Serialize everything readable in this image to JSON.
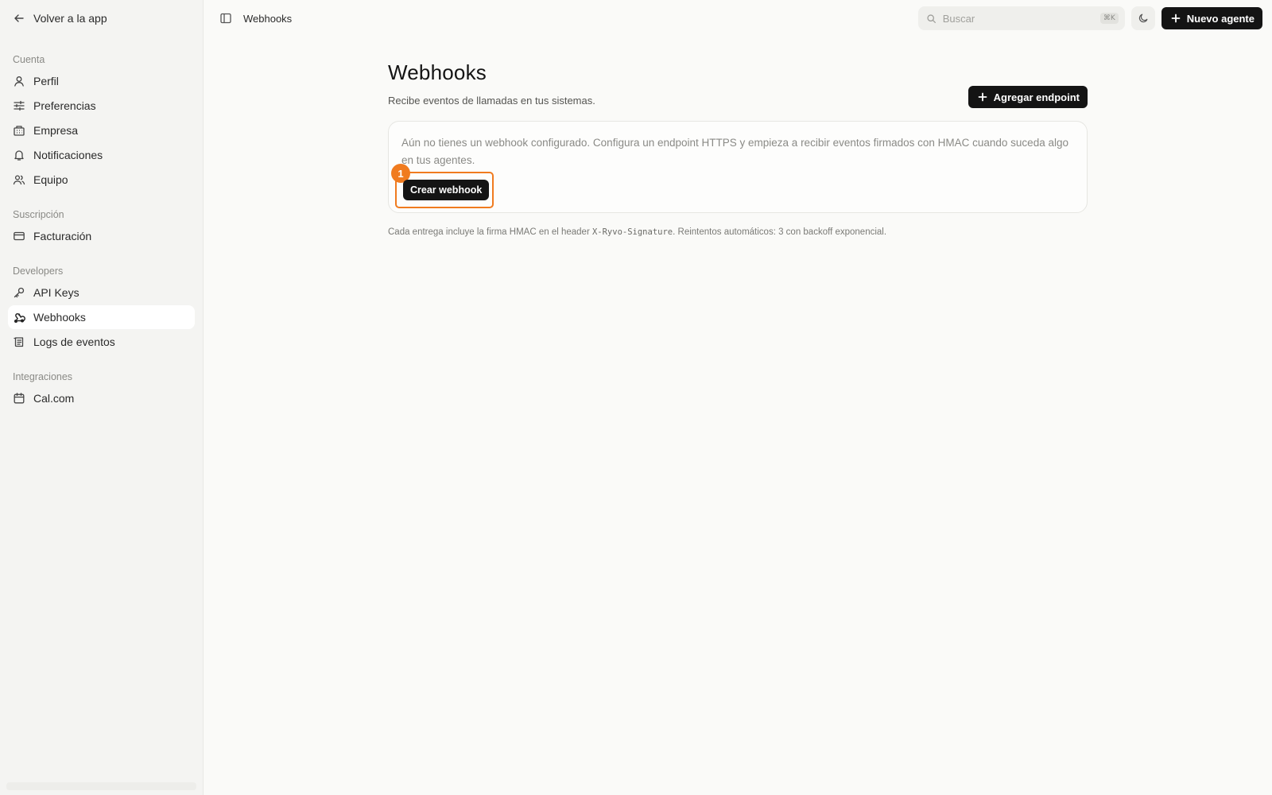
{
  "sidebar": {
    "back_label": "Volver a la app",
    "sections": [
      {
        "label": "Cuenta",
        "items": [
          {
            "label": "Perfil",
            "icon": "user-icon"
          },
          {
            "label": "Preferencias",
            "icon": "sliders-icon"
          },
          {
            "label": "Empresa",
            "icon": "building-icon"
          },
          {
            "label": "Notificaciones",
            "icon": "bell-icon"
          },
          {
            "label": "Equipo",
            "icon": "users-icon"
          }
        ]
      },
      {
        "label": "Suscripción",
        "items": [
          {
            "label": "Facturación",
            "icon": "credit-card-icon"
          }
        ]
      },
      {
        "label": "Developers",
        "items": [
          {
            "label": "API Keys",
            "icon": "key-icon"
          },
          {
            "label": "Webhooks",
            "icon": "webhook-icon",
            "active": true
          },
          {
            "label": "Logs de eventos",
            "icon": "log-icon"
          }
        ]
      },
      {
        "label": "Integraciones",
        "items": [
          {
            "label": "Cal.com",
            "icon": "calendar-icon"
          }
        ]
      }
    ]
  },
  "topbar": {
    "breadcrumb": "Webhooks",
    "search_placeholder": "Buscar",
    "search_shortcut": "⌘K",
    "new_agent_label": "Nuevo agente"
  },
  "page": {
    "title": "Webhooks",
    "subtitle": "Recibe eventos de llamadas en tus sistemas.",
    "add_endpoint_label": "Agregar endpoint",
    "empty_state_text": "Aún no tienes un webhook configurado. Configura un endpoint HTTPS y empieza a recibir eventos firmados con HMAC cuando suceda algo en tus agentes.",
    "create_webhook_label": "Crear webhook",
    "annotation_badge": "1",
    "footnote_before": "Cada entrega incluye la firma HMAC en el header ",
    "footnote_code": "X-Ryvo-Signature",
    "footnote_after": ". Reintentos automáticos: 3 con backoff exponencial."
  },
  "colors": {
    "accent_annotation": "#f07b1f",
    "primary_button": "#141414",
    "sidebar_bg": "#f4f4f2"
  }
}
